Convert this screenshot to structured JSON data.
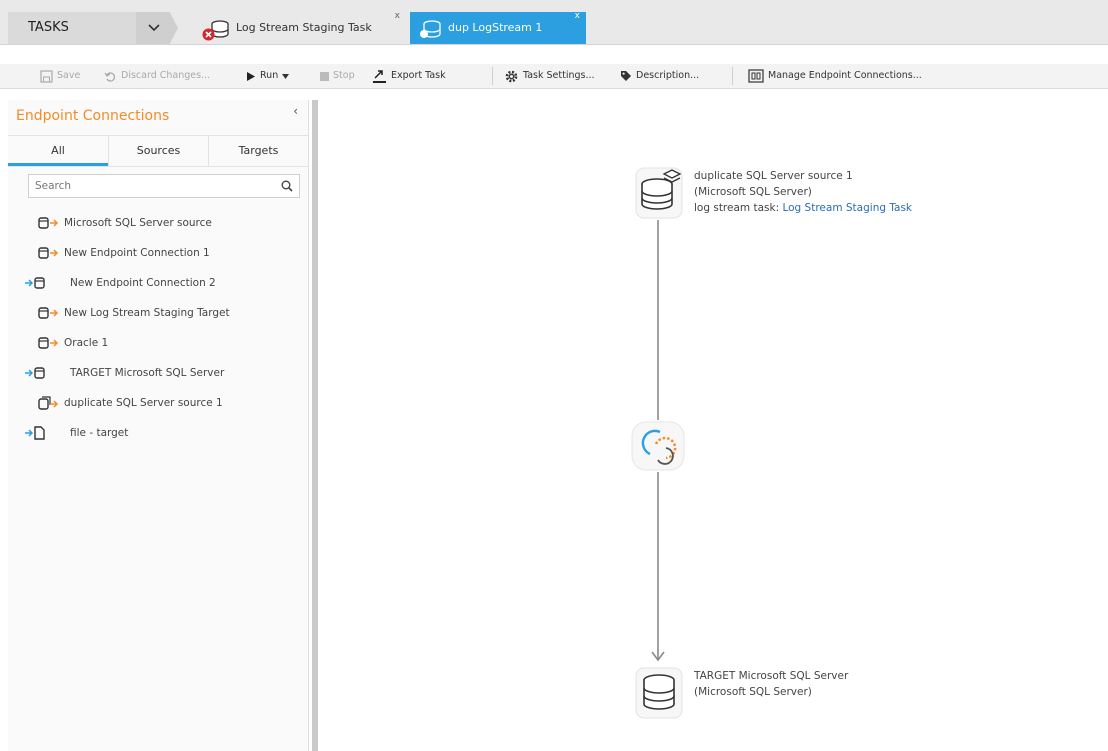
{
  "tabs_bar": {
    "tasks_label": "TASKS",
    "task_tabs": [
      {
        "label": "Log Stream Staging Task",
        "close": "x"
      },
      {
        "label": "dup LogStream 1",
        "close": "x"
      }
    ]
  },
  "toolbar": {
    "save": "Save",
    "discard": "Discard Changes...",
    "run": "Run",
    "stop": "Stop",
    "export": "Export Task",
    "task_settings": "Task Settings...",
    "description": "Description...",
    "manage_endpoints": "Manage Endpoint Connections..."
  },
  "sidebar": {
    "title": "Endpoint Connections",
    "collapse": "‹",
    "filter_tabs": [
      "All",
      "Sources",
      "Targets"
    ],
    "search_placeholder": "Search",
    "items": [
      {
        "label": "Microsoft SQL Server source",
        "role": "source"
      },
      {
        "label": "New Endpoint Connection 1",
        "role": "source"
      },
      {
        "label": "New Endpoint Connection 2",
        "role": "target"
      },
      {
        "label": "New Log Stream Staging Target",
        "role": "source"
      },
      {
        "label": "Oracle 1",
        "role": "source"
      },
      {
        "label": "TARGET Microsoft SQL Server",
        "role": "target"
      },
      {
        "label": "duplicate SQL Server source 1",
        "role": "source-dup"
      },
      {
        "label": "file - target",
        "role": "target-file"
      }
    ]
  },
  "canvas": {
    "source_node": {
      "name": "duplicate SQL Server source 1",
      "type": "(Microsoft SQL Server)",
      "log_stream_prefix": "log stream task:",
      "log_stream_link": "Log Stream Staging Task"
    },
    "target_node": {
      "name": "TARGET Microsoft SQL Server",
      "type": "(Microsoft SQL Server)"
    }
  },
  "colors": {
    "accent_blue": "#2b9fe0",
    "title_orange": "#f28c28",
    "link_blue": "#2a6eb5",
    "error_red": "#d9262c"
  }
}
